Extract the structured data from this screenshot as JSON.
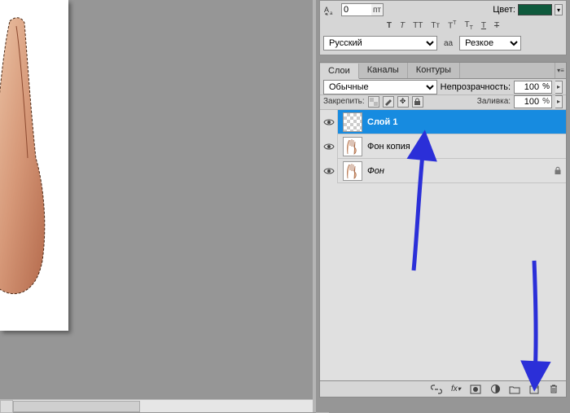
{
  "char_panel": {
    "kern_value": "0",
    "kern_unit": "пт",
    "color_label": "Цвет:",
    "color_hex": "#0f5a3d",
    "tt_buttons": [
      "T",
      "T",
      "TT",
      "Tt",
      "T¹",
      "T₁",
      "T",
      "T"
    ],
    "language": "Русский",
    "aa_prefix": "aа",
    "antialias": "Резкое"
  },
  "layers_panel": {
    "tabs": [
      "Слои",
      "Каналы",
      "Контуры"
    ],
    "active_tab": 0,
    "blend_mode": "Обычные",
    "opacity_label": "Непрозрачность:",
    "opacity_value": "100",
    "pct": "%",
    "lock_label": "Закрепить:",
    "fill_label": "Заливка:",
    "fill_value": "100",
    "layers": [
      {
        "name": "Слой 1",
        "visible": true,
        "selected": true,
        "thumb": "transparent",
        "italic": false,
        "locked": false
      },
      {
        "name": "Фон копия",
        "visible": true,
        "selected": false,
        "thumb": "hand",
        "italic": false,
        "locked": false
      },
      {
        "name": "Фон",
        "visible": true,
        "selected": false,
        "thumb": "hand",
        "italic": true,
        "locked": true
      }
    ],
    "bottom_icons": [
      "link-icon",
      "fx-icon",
      "mask-icon",
      "adjust-icon",
      "group-icon",
      "new-layer-icon",
      "trash-icon"
    ]
  }
}
